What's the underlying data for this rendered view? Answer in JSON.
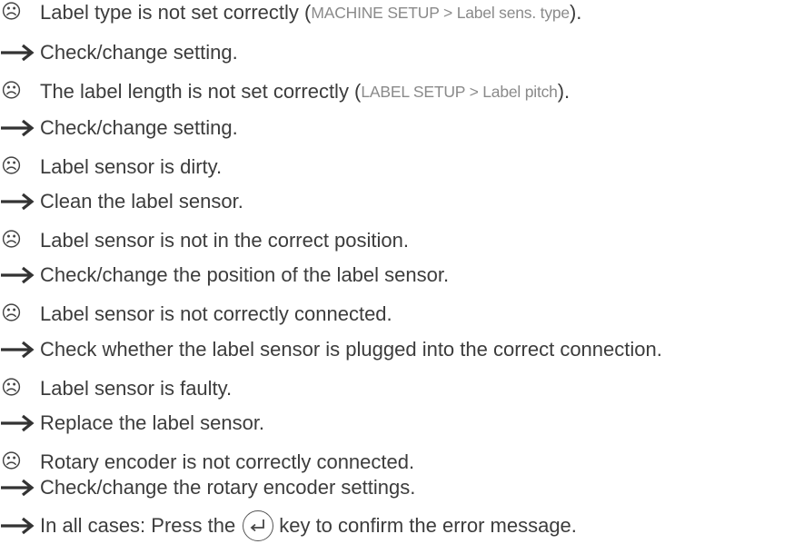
{
  "items": [
    {
      "cause_pre": "Label type is not set correctly (",
      "cause_ref": "MACHINE SETUP > Label sens. type",
      "cause_post": ").",
      "fix": "Check/change setting."
    },
    {
      "cause_pre": "The label length is not set correctly (",
      "cause_ref": "LABEL SETUP > Label pitch",
      "cause_post": ").",
      "fix": "Check/change setting."
    },
    {
      "cause_pre": "Label sensor is dirty.",
      "cause_ref": "",
      "cause_post": "",
      "fix": "Clean the label sensor."
    },
    {
      "cause_pre": "Label sensor is not in the correct position.",
      "cause_ref": "",
      "cause_post": "",
      "fix": "Check/change the position of the label sensor."
    },
    {
      "cause_pre": "Label sensor is not correctly connected.",
      "cause_ref": "",
      "cause_post": "",
      "fix": "Check whether the label sensor is plugged into the correct connection."
    },
    {
      "cause_pre": "Label sensor is faulty.",
      "cause_ref": "",
      "cause_post": "",
      "fix": "Replace the label sensor."
    },
    {
      "cause_pre": "Rotary encoder is not correctly connected.",
      "cause_ref": "",
      "cause_post": "",
      "fix": "Check/change the rotary encoder settings."
    }
  ],
  "final": {
    "before_key": "In all cases: Press the",
    "after_key": "key to confirm the error message."
  },
  "icons": {
    "cause": "frown-face-icon",
    "fix": "right-arrow-icon",
    "key": "enter-key-icon"
  },
  "colors": {
    "text": "#3c3c3c",
    "menu_reference": "#8a8a8a"
  }
}
